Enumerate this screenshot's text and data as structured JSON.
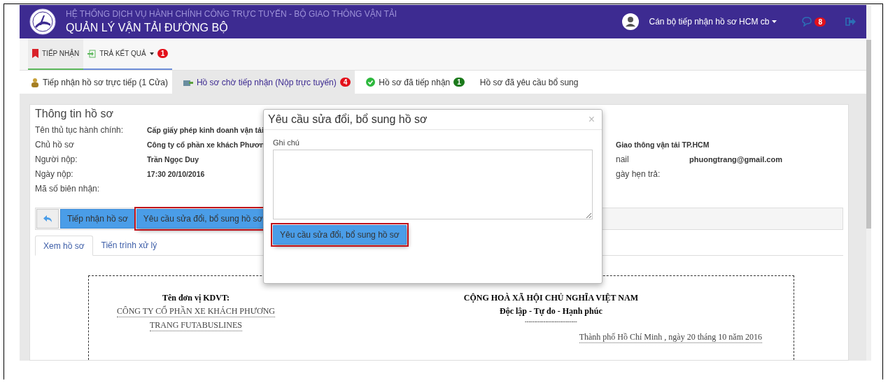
{
  "header": {
    "subtitle": "HỆ THỐNG DỊCH VỤ HÀNH CHÍNH CÔNG TRỰC TUYẾN - BỘ GIAO THÔNG VẬN TẢI",
    "title": "QUẢN LÝ VẬN TẢI ĐƯỜNG BỘ",
    "user": "Cán bộ tiếp nhận hồ sơ HCM cb",
    "messages_badge": "8"
  },
  "nav": [
    {
      "label": "TIẾP NHẬN",
      "selected": true,
      "dropdown": false
    },
    {
      "label": "TRẢ KẾT QUẢ",
      "selected": false,
      "dropdown": true,
      "badge": "1"
    }
  ],
  "tabs": [
    {
      "label": "Tiếp nhận hồ sơ trực tiếp (1 Cửa)",
      "selected": false
    },
    {
      "label": "Hồ sơ chờ tiếp nhận (Nộp trực tuyến)",
      "selected": true,
      "badge": "4",
      "color": "#e3101a"
    },
    {
      "label": "Hồ sơ đã tiếp nhận",
      "selected": false,
      "badge": "1",
      "color": "#1b7a1b"
    },
    {
      "label": "Hồ sơ đã yêu cầu bổ sung",
      "selected": false
    }
  ],
  "record": {
    "title": "Thông tin hồ sơ",
    "rows": [
      {
        "label": "Tên thủ tục hành chính:",
        "value": "Cấp giấy phép kinh doanh vận tải"
      },
      {
        "label": "Chủ hồ sơ",
        "value": "Công ty cổ phần xe khách Phươn",
        "right_value": "Giao thông vận tải TP.HCM"
      },
      {
        "label": "Người nộp:",
        "value": "Trần Ngọc Duy",
        "right_label": "nail",
        "right_value": "phuongtrang@gmail.com"
      },
      {
        "label": "Ngày nộp:",
        "value": "17:30 20/10/2016",
        "right_label": "gày hẹn trả:"
      },
      {
        "label": "Mã số biên nhận:"
      }
    ],
    "actions": [
      {
        "label": "Tiếp nhận hồ sơ",
        "highlighted": false
      },
      {
        "label": "Yêu cầu sửa đổi, bổ sung hồ sơ",
        "highlighted": true
      }
    ],
    "view_tabs": [
      {
        "label": "Xem hồ sơ",
        "selected": true
      },
      {
        "label": "Tiến trình xử lý",
        "selected": false
      }
    ]
  },
  "document": {
    "unit_label": "Tên đơn vị KDVT:",
    "unit_lines": [
      "CÔNG TY CỔ PHẦN XE KHÁCH PHƯƠNG",
      "TRANG FUTABUSLINES"
    ],
    "nation": "CỘNG HOÀ XÃ HỘI CHỦ NGHĨA VIỆT NAM",
    "motto": "Độc lập - Tự do - Hạnh phúc",
    "rule": "----------------------------",
    "place_date": "Thành phố Hồ Chí Minh , ngày 20 tháng 10 năm 2016"
  },
  "modal": {
    "title": "Yêu cầu sửa đổi, bổ sung hồ sơ",
    "close": "×",
    "note_label": "Ghi chú",
    "submit": "Yêu cầu sửa đổi, bổ sung hồ sơ",
    "submit_highlighted": true
  }
}
